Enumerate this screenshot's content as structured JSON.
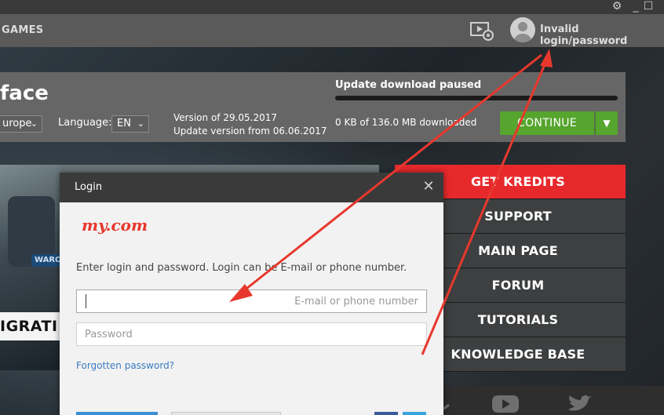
{
  "window": {
    "settings_icon": "gear-icon",
    "minimize_icon": "minimize-icon",
    "maximize_icon": "maximize-icon"
  },
  "topnav": {
    "games_label": "GAMES",
    "media_icon": "video-camera-icon",
    "user_status": "Invalid login/password"
  },
  "game": {
    "title": "face",
    "region": "urope",
    "language_label": "Language:",
    "language": "EN",
    "version": "Version of 29.05.2017",
    "update_version": "Update version from 06.06.2017"
  },
  "update": {
    "status": "Update download paused",
    "progress": 0,
    "size": "0 KB of 136.0 MB downloaded",
    "continue_label": "CONTINUE"
  },
  "promo": {
    "badge": "WARO",
    "banner": "IGRATI"
  },
  "side_menu": [
    {
      "label": "GET KREDITS",
      "name": "menu-get-kredits"
    },
    {
      "label": "SUPPORT",
      "name": "menu-support"
    },
    {
      "label": "MAIN PAGE",
      "name": "menu-main-page"
    },
    {
      "label": "FORUM",
      "name": "menu-forum"
    },
    {
      "label": "TUTORIALS",
      "name": "menu-tutorials"
    },
    {
      "label": "KNOWLEDGE BASE",
      "name": "menu-knowledge-base"
    }
  ],
  "login": {
    "title": "Login",
    "close_icon": "close-icon",
    "brand": "my.com",
    "instructions": "Enter login and password. Login can be E-mail or phone number.",
    "login_placeholder": "E-mail or phone number",
    "password_placeholder": "Password",
    "forgot_label": "Forgotten password?"
  },
  "colors": {
    "accent_red": "#e8292c",
    "continue_green": "#56a52e",
    "link_blue": "#3a7bc0",
    "arrow_red": "#e8382d"
  }
}
